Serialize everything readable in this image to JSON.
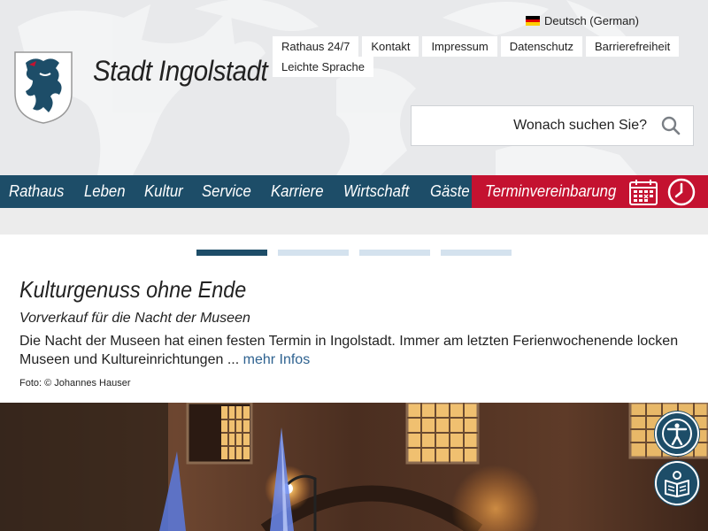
{
  "header": {
    "site_title": "Stadt Ingolstadt",
    "language": "Deutsch (German)",
    "util_links": [
      "Rathaus 24/7",
      "Kontakt",
      "Impressum",
      "Datenschutz",
      "Barrierefreiheit",
      "Leichte Sprache"
    ],
    "search_placeholder": "Wonach suchen Sie?"
  },
  "nav": {
    "items": [
      "Rathaus",
      "Leben",
      "Kultur",
      "Service",
      "Karriere",
      "Wirtschaft",
      "Gäste"
    ],
    "cta_label": "Terminvereinbarung"
  },
  "slider": {
    "active_index": 0,
    "slide_count": 4,
    "title": "Kulturgenuss ohne Ende",
    "subtitle": "Vorverkauf für die Nacht der Museen",
    "text": "Die Nacht der Museen hat einen festen Termin in Ingolstadt. Immer am letzten Ferienwochenende locken Museen und Kultureinrichtungen ...",
    "more_link": "mehr Infos",
    "credit": "Foto: © Johannes Hauser"
  },
  "colors": {
    "brand_blue": "#1d4d68",
    "brand_red": "#c41230",
    "link": "#2e6290"
  },
  "icons": {
    "accessibility": "accessibility-person-icon",
    "easy_language": "easy-language-book-icon",
    "search": "search-icon",
    "calendar": "calendar-icon",
    "clock": "clock-icon"
  }
}
